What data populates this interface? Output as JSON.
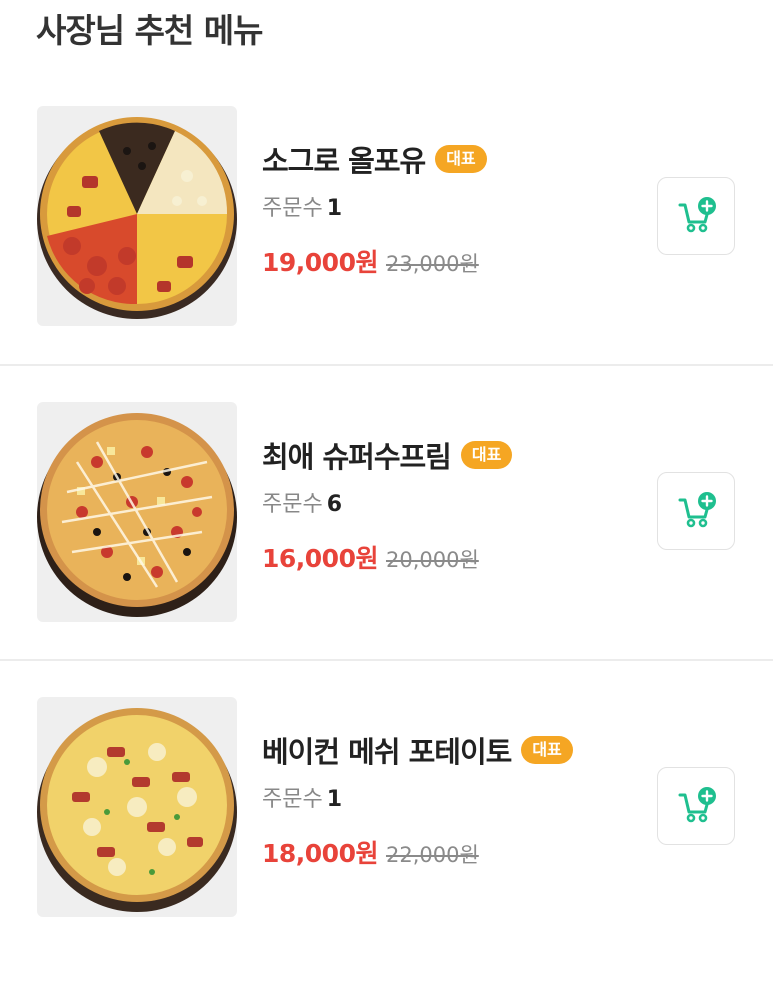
{
  "section": {
    "title": "사장님 추천 메뉴"
  },
  "menu": [
    {
      "name": "소그로 올포유",
      "badge": "대표",
      "orders_label": "주문수",
      "orders": "1",
      "price": "19,000원",
      "original_price": "23,000원"
    },
    {
      "name": "최애 슈퍼수프림",
      "badge": "대표",
      "orders_label": "주문수",
      "orders": "6",
      "price": "16,000원",
      "original_price": "20,000원"
    },
    {
      "name": "베이컨 메쉬 포테이토",
      "badge": "대표",
      "orders_label": "주문수",
      "orders": "1",
      "price": "18,000원",
      "original_price": "22,000원"
    }
  ],
  "colors": {
    "price": "#e8433a",
    "badge": "#f5a623",
    "cart_icon": "#1fbf8f"
  },
  "icons": {
    "cart": "cart-plus-icon"
  }
}
